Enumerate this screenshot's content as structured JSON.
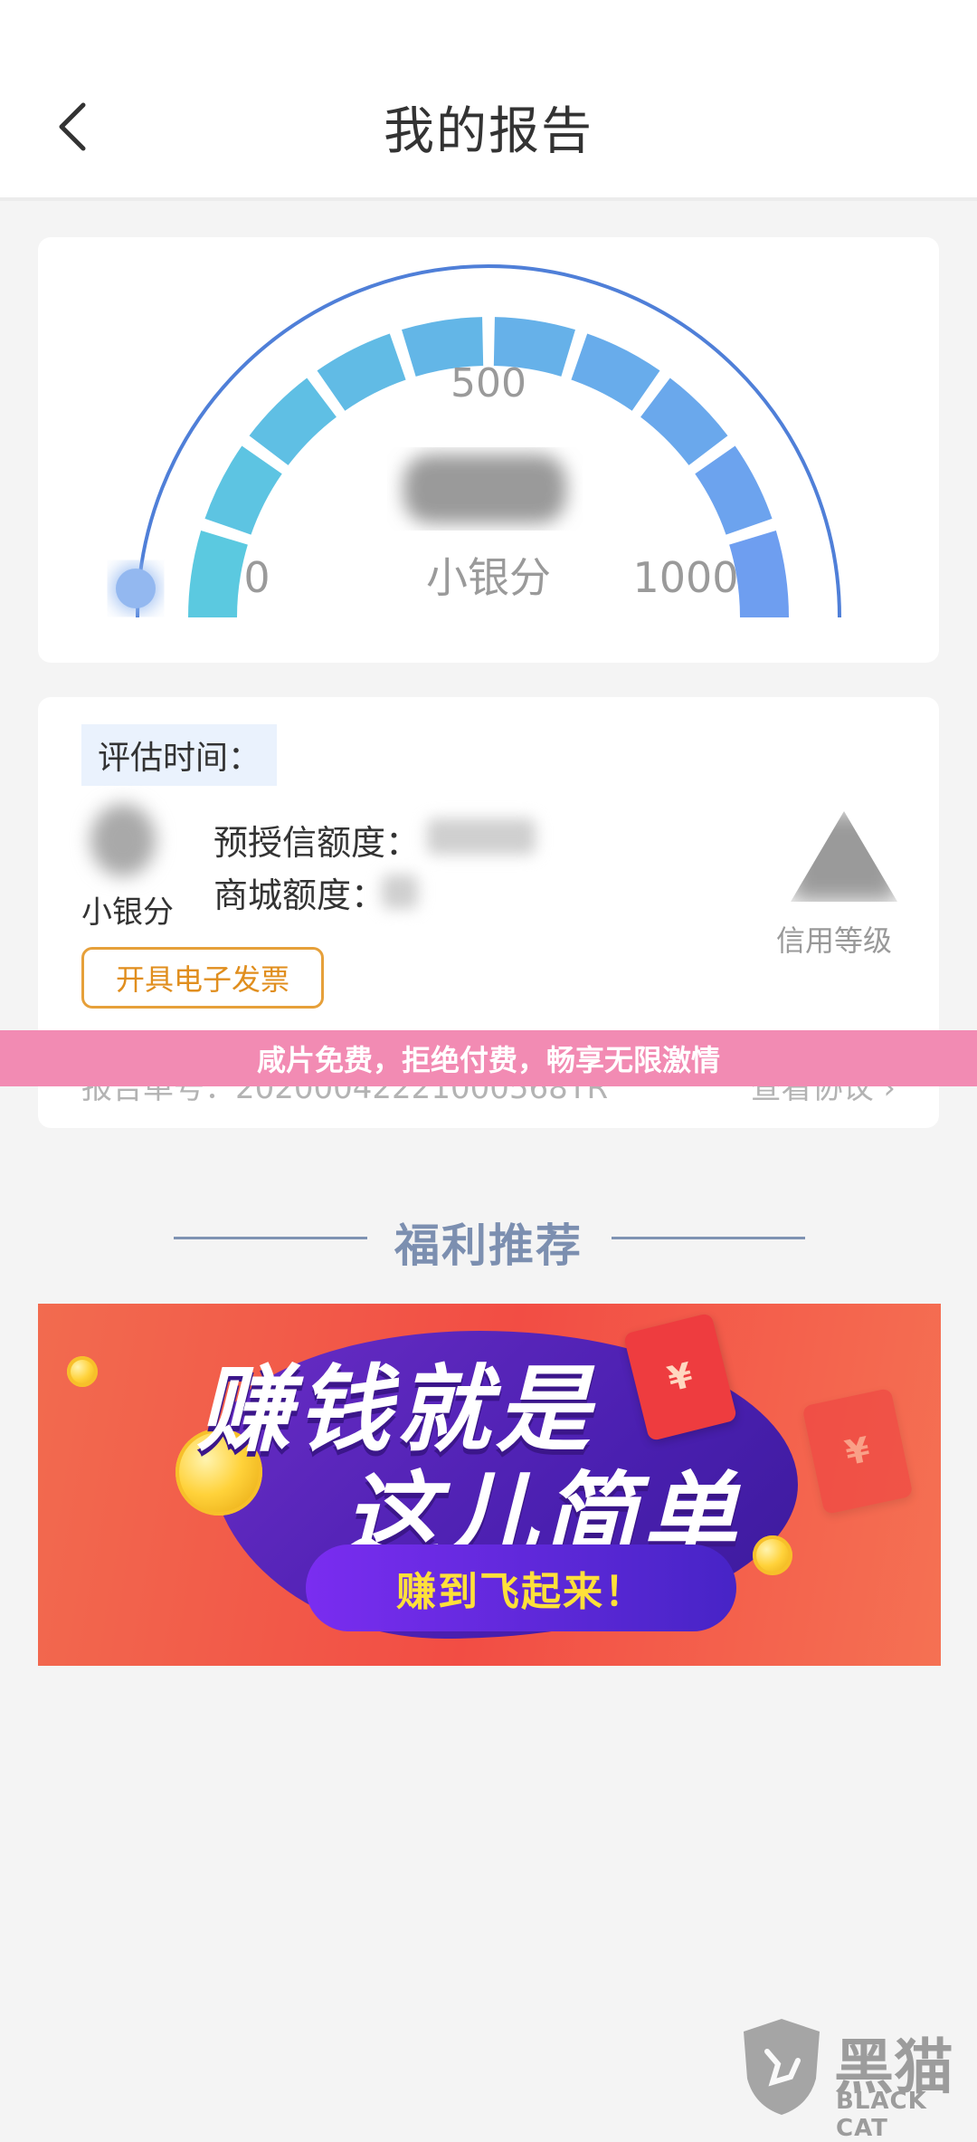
{
  "header": {
    "title": "我的报告",
    "back_icon": "chevron-left-icon"
  },
  "gauge": {
    "min_label": "0",
    "mid_label": "500",
    "max_label": "1000",
    "score_label": "小银分",
    "score_value_obscured": true,
    "colors": {
      "start": "#5bc9e0",
      "end": "#6e9ef0",
      "outer_arc": "#4f7fd8",
      "marker": "#93b8f0"
    }
  },
  "report": {
    "eval_time_label": "评估时间：",
    "score_label": "小银分",
    "credit_label": "预授信额度：",
    "mall_label": "商城额度：",
    "level_label": "信用等级",
    "invoice_button": "开具电子发票",
    "report_no": "报告单号：20200042221000568TR",
    "agreement": "查看协议 ›"
  },
  "overlay_banner": "咸片免费，拒绝付费，畅享无限激情",
  "welfare": {
    "title": "福利推荐"
  },
  "promo": {
    "line1": "赚钱就是",
    "line2": "这儿简单",
    "cta": "赚到飞起来！",
    "yen": "¥"
  },
  "watermark": {
    "text": "黑猫",
    "sub": "BLACK CAT"
  }
}
